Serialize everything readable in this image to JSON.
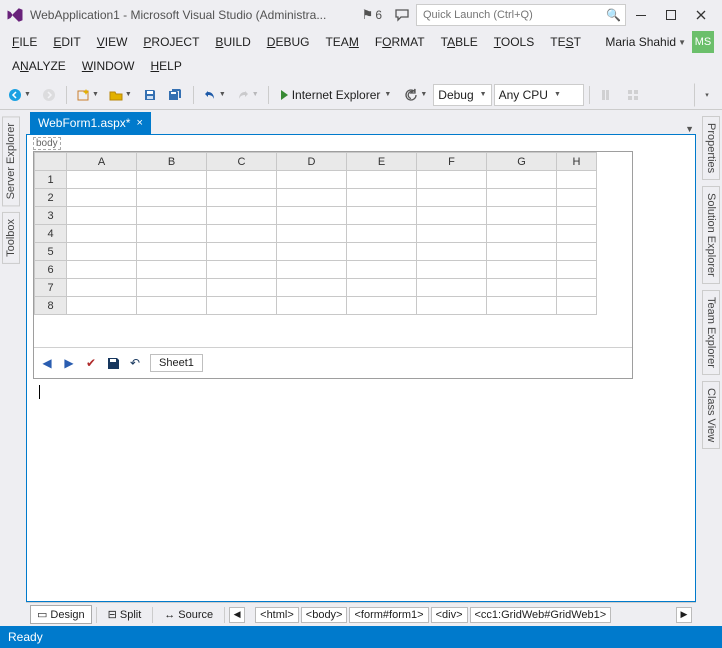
{
  "title": "WebApplication1 - Microsoft Visual Studio (Administra...",
  "notification_count": "6",
  "quick_launch_placeholder": "Quick Launch (Ctrl+Q)",
  "user_name": "Maria Shahid",
  "user_initials": "MS",
  "menu": {
    "row1": [
      "FILE",
      "EDIT",
      "VIEW",
      "PROJECT",
      "BUILD",
      "DEBUG",
      "TEAM",
      "FORMAT",
      "TABLE",
      "TOOLS",
      "TEST"
    ],
    "row2": [
      "ANALYZE",
      "WINDOW",
      "HELP"
    ]
  },
  "toolbar": {
    "start_label": "Internet Explorer",
    "config": "Debug",
    "platform": "Any CPU"
  },
  "left_tabs": [
    "Server Explorer",
    "Toolbox"
  ],
  "right_tabs": [
    "Properties",
    "Solution Explorer",
    "Team Explorer",
    "Class View"
  ],
  "doc_tab": "WebForm1.aspx*",
  "body_tag": "body",
  "grid": {
    "columns": [
      "A",
      "B",
      "C",
      "D",
      "E",
      "F",
      "G",
      "H"
    ],
    "rows": [
      "1",
      "2",
      "3",
      "4",
      "5",
      "6",
      "7",
      "8"
    ],
    "sheet": "Sheet1"
  },
  "viewbar": {
    "design": "Design",
    "split": "Split",
    "source": "Source",
    "crumbs": [
      "<html>",
      "<body>",
      "<form#form1>",
      "<div>",
      "<cc1:GridWeb#GridWeb1>"
    ]
  },
  "status": "Ready"
}
